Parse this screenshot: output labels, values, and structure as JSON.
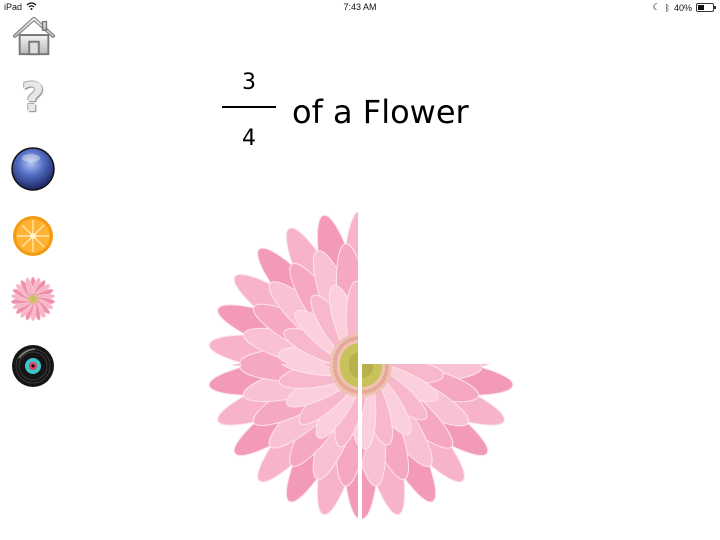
{
  "status_bar": {
    "device": "iPad",
    "time": "7:43 AM",
    "battery": "40%",
    "battery_level": 0.4
  },
  "sidebar": {
    "items": [
      {
        "name": "home",
        "icon": "house-icon"
      },
      {
        "name": "help",
        "icon": "question-mark-icon",
        "glyph": "?"
      },
      {
        "name": "ball",
        "icon": "blue-ball-icon"
      },
      {
        "name": "orange",
        "icon": "orange-slice-icon"
      },
      {
        "name": "flower",
        "icon": "pink-flower-icon"
      },
      {
        "name": "record",
        "icon": "vinyl-record-icon"
      }
    ]
  },
  "title": {
    "numerator": "3",
    "denominator": "4",
    "text": "of a Flower"
  },
  "flower": {
    "pieces_shown": 3,
    "pieces_total": 4,
    "petal_color": "#f5a3bd",
    "center_color": "#c9c25a"
  }
}
